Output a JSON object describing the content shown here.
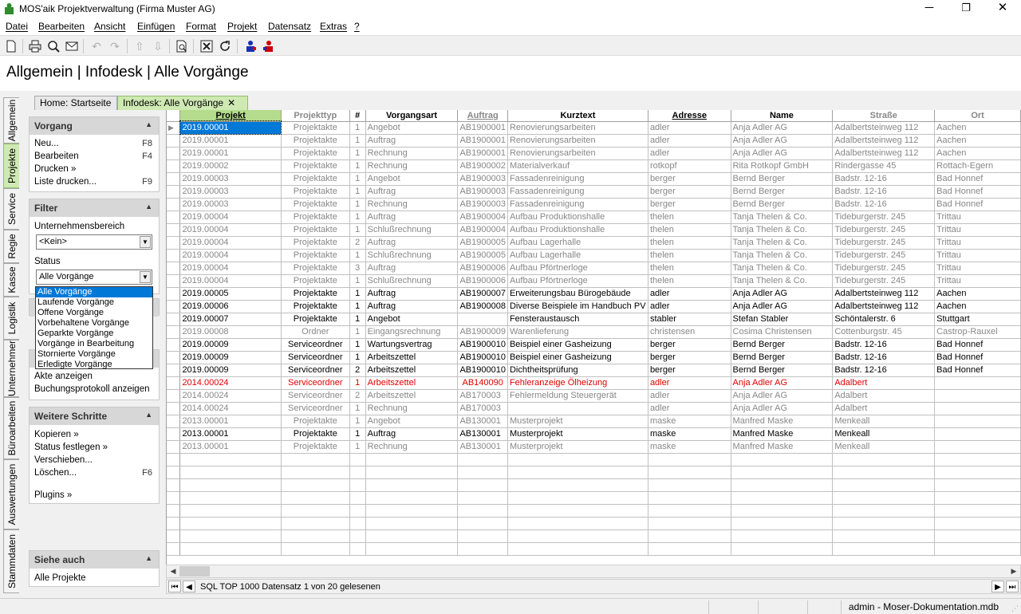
{
  "window": {
    "title": "MOS'aik Projektverwaltung (Firma Muster AG)",
    "minimize": "─",
    "restore": "❐",
    "close": "✕"
  },
  "menu": [
    "Datei",
    "Bearbeiten",
    "Ansicht",
    "Einfügen",
    "Format",
    "Projekt",
    "Datensatz",
    "Extras",
    "?"
  ],
  "page": {
    "title": "Allgemein | Infodesk | Alle Vorgänge"
  },
  "vtabs": [
    "Allgemein",
    "Projekte",
    "Service",
    "Regie",
    "Kasse",
    "Logistik",
    "Unternehmer",
    "Büroarbeiten",
    "Auswertungen",
    "Stammdaten"
  ],
  "doctabs": {
    "home": "Home: Startseite",
    "active": "Infodesk: Alle Vorgänge",
    "close": "✕"
  },
  "panel": {
    "vorgang": {
      "title": "Vorgang",
      "items": [
        {
          "label": "Neu...",
          "key": "F8"
        },
        {
          "label": "Bearbeiten",
          "key": "F4"
        },
        {
          "label": "Drucken »",
          "key": ""
        },
        {
          "label": "Liste drucken...",
          "key": "F9"
        }
      ]
    },
    "filter": {
      "title": "Filter",
      "unternehmensbereich_label": "Unternehmensbereich",
      "unternehmensbereich_value": "<Kein>",
      "status_label": "Status",
      "status_value": "Alle Vorgänge",
      "status_options": [
        "Alle Vorgänge",
        "Laufende Vorgänge",
        "Offene Vorgänge",
        "Vorbehaltene Vorgänge",
        "Geparkte Vorgänge",
        "Vorgänge in Bearbeitung",
        "Stornierte Vorgänge",
        "Erledigte Vorgänge"
      ]
    },
    "extra_items": [
      "Akte anzeigen",
      "Buchungsprotokoll anzeigen"
    ],
    "weitere": {
      "title": "Weitere Schritte",
      "items": [
        {
          "label": "Kopieren »",
          "key": ""
        },
        {
          "label": "Status festlegen »",
          "key": ""
        },
        {
          "label": "Verschieben...",
          "key": ""
        },
        {
          "label": "Löschen...",
          "key": "F6"
        }
      ],
      "plugins": "Plugins »"
    },
    "siehe": {
      "title": "Siehe auch",
      "items": [
        "Alle Projekte"
      ]
    }
  },
  "grid": {
    "columns": [
      "Projekt",
      "Projekttyp",
      "#",
      "Vorgangsart",
      "Auftrag",
      "Kurztext",
      "Adresse",
      "Name",
      "Straße",
      "Ort"
    ],
    "rows": [
      {
        "s": "g",
        "cells": [
          "2019.00001",
          "Projektakte",
          "1",
          "Angebot",
          "AB1900001",
          "Renovierungsarbeiten",
          "adler",
          "Anja Adler AG",
          "Adalbertsteinweg 112",
          "Aachen"
        ]
      },
      {
        "s": "g",
        "cells": [
          "2019.00001",
          "Projektakte",
          "1",
          "Auftrag",
          "AB1900001",
          "Renovierungsarbeiten",
          "adler",
          "Anja Adler AG",
          "Adalbertsteinweg 112",
          "Aachen"
        ]
      },
      {
        "s": "g",
        "cells": [
          "2019.00001",
          "Projektakte",
          "1",
          "Rechnung",
          "AB1900001",
          "Renovierungsarbeiten",
          "adler",
          "Anja Adler AG",
          "Adalbertsteinweg 112",
          "Aachen"
        ]
      },
      {
        "s": "g",
        "cells": [
          "2019.00002",
          "Projektakte",
          "1",
          "Rechnung",
          "AB1900002",
          "Materialverkauf",
          "rotkopf",
          "Rita Rotkopf GmbH",
          "Rindergasse 45",
          "Rottach-Egern"
        ]
      },
      {
        "s": "g",
        "cells": [
          "2019.00003",
          "Projektakte",
          "1",
          "Angebot",
          "AB1900003",
          "Fassadenreinigung",
          "berger",
          "Bernd Berger",
          "Badstr. 12-16",
          "Bad Honnef"
        ]
      },
      {
        "s": "g",
        "cells": [
          "2019.00003",
          "Projektakte",
          "1",
          "Auftrag",
          "AB1900003",
          "Fassadenreinigung",
          "berger",
          "Bernd Berger",
          "Badstr. 12-16",
          "Bad Honnef"
        ]
      },
      {
        "s": "g",
        "cells": [
          "2019.00003",
          "Projektakte",
          "1",
          "Rechnung",
          "AB1900003",
          "Fassadenreinigung",
          "berger",
          "Bernd Berger",
          "Badstr. 12-16",
          "Bad Honnef"
        ]
      },
      {
        "s": "g",
        "cells": [
          "2019.00004",
          "Projektakte",
          "1",
          "Auftrag",
          "AB1900004",
          "Aufbau Produktionshalle",
          "thelen",
          "Tanja Thelen & Co.",
          "Tideburgerstr. 245",
          "Trittau"
        ]
      },
      {
        "s": "g",
        "cells": [
          "2019.00004",
          "Projektakte",
          "1",
          "Schlußrechnung",
          "AB1900004",
          "Aufbau Produktionshalle",
          "thelen",
          "Tanja Thelen & Co.",
          "Tideburgerstr. 245",
          "Trittau"
        ]
      },
      {
        "s": "g",
        "cells": [
          "2019.00004",
          "Projektakte",
          "2",
          "Auftrag",
          "AB1900005",
          "Aufbau Lagerhalle",
          "thelen",
          "Tanja Thelen & Co.",
          "Tideburgerstr. 245",
          "Trittau"
        ]
      },
      {
        "s": "g",
        "cells": [
          "2019.00004",
          "Projektakte",
          "1",
          "Schlußrechnung",
          "AB1900005",
          "Aufbau Lagerhalle",
          "thelen",
          "Tanja Thelen & Co.",
          "Tideburgerstr. 245",
          "Trittau"
        ]
      },
      {
        "s": "g",
        "cells": [
          "2019.00004",
          "Projektakte",
          "3",
          "Auftrag",
          "AB1900006",
          "Aufbau Pförtnerloge",
          "thelen",
          "Tanja Thelen & Co.",
          "Tideburgerstr. 245",
          "Trittau"
        ]
      },
      {
        "s": "g",
        "cells": [
          "2019.00004",
          "Projektakte",
          "1",
          "Schlußrechnung",
          "AB1900006",
          "Aufbau Pförtnerloge",
          "thelen",
          "Tanja Thelen & Co.",
          "Tideburgerstr. 245",
          "Trittau"
        ]
      },
      {
        "s": "d",
        "cells": [
          "2019.00005",
          "Projektakte",
          "1",
          "Auftrag",
          "AB1900007",
          "Erweiterungsbau Bürogebäude",
          "adler",
          "Anja Adler AG",
          "Adalbertsteinweg 112",
          "Aachen"
        ]
      },
      {
        "s": "d",
        "cells": [
          "2019.00006",
          "Projektakte",
          "1",
          "Auftrag",
          "AB1900008",
          "Diverse Beispiele im Handbuch PV",
          "adler",
          "Anja Adler AG",
          "Adalbertsteinweg 112",
          "Aachen"
        ]
      },
      {
        "s": "d",
        "cells": [
          "2019.00007",
          "Projektakte",
          "1",
          "Angebot",
          "",
          "Fensteraustausch",
          "stabler",
          "Stefan Stabler",
          "Schöntalerstr. 6",
          "Stuttgart"
        ]
      },
      {
        "s": "g",
        "cells": [
          "2019.00008",
          "Ordner",
          "1",
          "Eingangsrechnung",
          "AB1900009",
          "Warenlieferung",
          "christensen",
          "Cosima Christensen",
          "Cottenburgstr. 45",
          "Castrop-Rauxel"
        ]
      },
      {
        "s": "d",
        "cells": [
          "2019.00009",
          "Serviceordner",
          "1",
          "Wartungsvertrag",
          "AB1900010",
          "Beispiel einer Gasheizung",
          "berger",
          "Bernd Berger",
          "Badstr. 12-16",
          "Bad Honnef"
        ]
      },
      {
        "s": "d",
        "cells": [
          "2019.00009",
          "Serviceordner",
          "1",
          "Arbeitszettel",
          "AB1900010",
          "Beispiel einer Gasheizung",
          "berger",
          "Bernd Berger",
          "Badstr. 12-16",
          "Bad Honnef"
        ]
      },
      {
        "s": "d",
        "cells": [
          "2019.00009",
          "Serviceordner",
          "2",
          "Arbeitszettel",
          "AB1900010",
          "Dichtheitsprüfung",
          "berger",
          "Bernd Berger",
          "Badstr. 12-16",
          "Bad Honnef"
        ]
      },
      {
        "s": "r",
        "cells": [
          "2014.00024",
          "Serviceordner",
          "1",
          "Arbeitszettel",
          "AB140090",
          "Fehleranzeige Ölheizung",
          "adler",
          "Anja Adler AG",
          "Adalbert",
          ""
        ]
      },
      {
        "s": "g",
        "cells": [
          "2014.00024",
          "Serviceordner",
          "2",
          "Arbeitszettel",
          "AB170003",
          "Fehlermeldung Steuergerät",
          "adler",
          "Anja Adler AG",
          "Adalbert",
          ""
        ]
      },
      {
        "s": "g",
        "cells": [
          "2014.00024",
          "Serviceordner",
          "1",
          "Rechnung",
          "AB170003",
          "",
          "adler",
          "Anja Adler AG",
          "Adalbert",
          ""
        ]
      },
      {
        "s": "g",
        "cells": [
          "2013.00001",
          "Projektakte",
          "1",
          "Angebot",
          "AB130001",
          "Musterprojekt",
          "maske",
          "Manfred Maske",
          "Menkeall",
          ""
        ]
      },
      {
        "s": "d",
        "cells": [
          "2013.00001",
          "Projektakte",
          "1",
          "Auftrag",
          "AB130001",
          "Musterprojekt",
          "maske",
          "Manfred Maske",
          "Menkeall",
          ""
        ]
      },
      {
        "s": "g",
        "cells": [
          "2013.00001",
          "Projektakte",
          "1",
          "Rechnung",
          "AB130001",
          "Musterprojekt",
          "maske",
          "Manfred Maske",
          "Menkeall",
          ""
        ]
      }
    ]
  },
  "navbar": {
    "text": "SQL TOP 1000 Datensatz 1 von 20 gelesenen"
  },
  "status": {
    "text": "admin - Moser-Dokumentation.mdb"
  }
}
